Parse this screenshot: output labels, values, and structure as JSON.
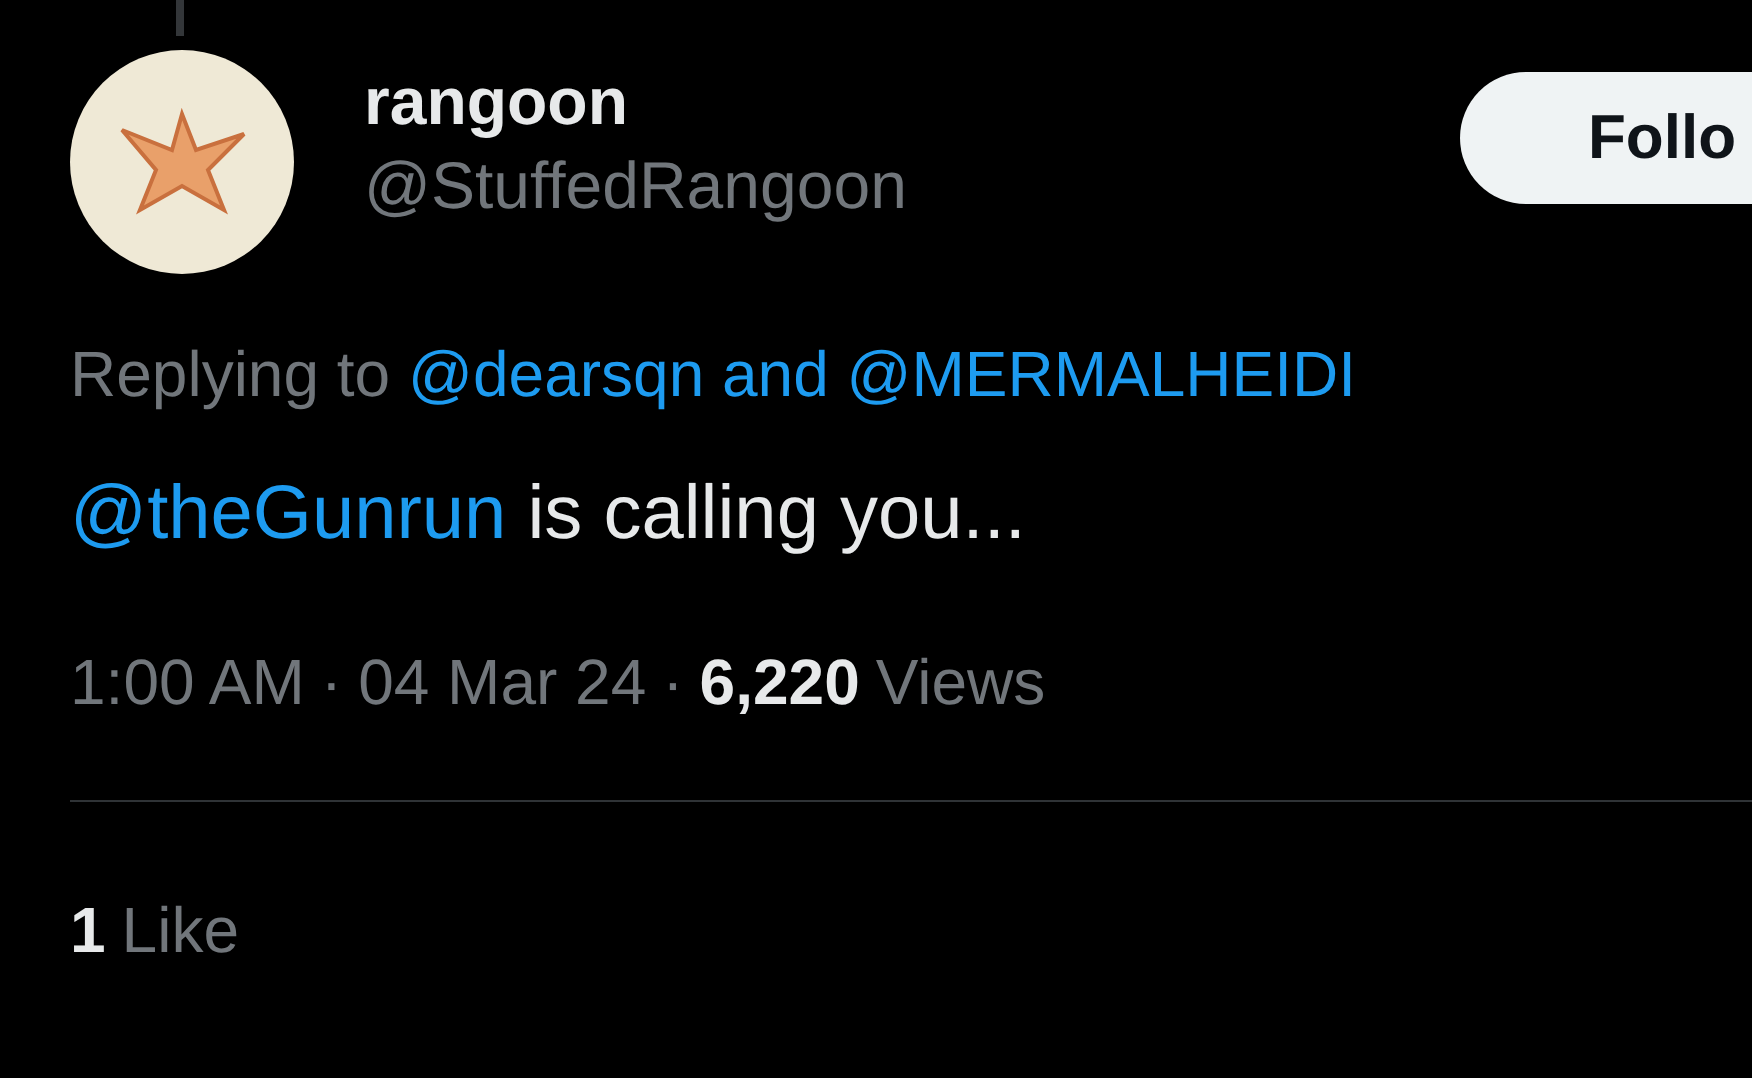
{
  "author": {
    "name": "rangoon",
    "handle": "@StuffedRangoon"
  },
  "follow_button": {
    "label": "Follo"
  },
  "replying": {
    "prefix": "Replying to",
    "mentions": [
      "@dearsqn",
      "@MERMALHEIDI"
    ],
    "joiner": "and"
  },
  "tweet": {
    "mention": "@theGunrun",
    "text": "is calling you..."
  },
  "meta": {
    "time": "1:00 AM",
    "separator_1": "·",
    "date": "04 Mar 24",
    "separator_2": "·",
    "views_count": "6,220",
    "views_label": "Views"
  },
  "likes": {
    "count": "1",
    "label": "Like"
  }
}
